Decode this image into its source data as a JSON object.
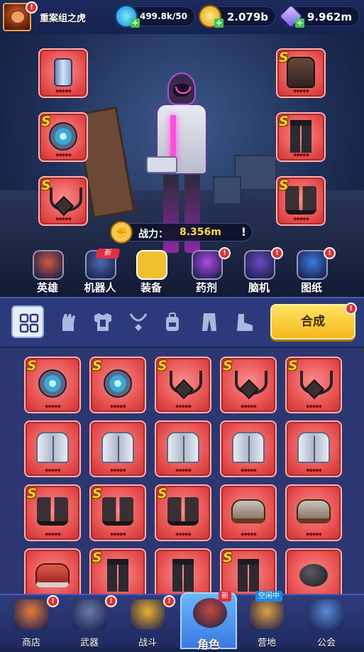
{
  "player": {
    "name": "重案组之虎"
  },
  "resources": {
    "energy": {
      "value": "499.8k/50",
      "icon": "energy-icon"
    },
    "coins": {
      "value": "2.079b",
      "icon": "coin-icon"
    },
    "gems": {
      "value": "9.962m",
      "icon": "gem-icon"
    }
  },
  "power": {
    "label": "战力：",
    "value": "8.356m",
    "info": "!"
  },
  "equipped": {
    "left": [
      {
        "item": "canister",
        "rank": "",
        "stars": 5
      },
      {
        "item": "shield",
        "rank": "S",
        "stars": 5
      },
      {
        "item": "necklace",
        "rank": "S",
        "stars": 5
      }
    ],
    "right": [
      {
        "item": "vest",
        "rank": "S",
        "stars": 5
      },
      {
        "item": "pants",
        "rank": "S",
        "stars": 5
      },
      {
        "item": "boots",
        "rank": "S",
        "stars": 5
      }
    ]
  },
  "categories": [
    {
      "label": "英雄",
      "icon": "hero-icon",
      "color": "#d05a3a",
      "new": false,
      "alert": false
    },
    {
      "label": "机器人",
      "icon": "robot-icon",
      "color": "#4a6ab0",
      "new": true,
      "new_label": "新",
      "alert": false
    },
    {
      "label": "装备",
      "icon": "equipment-icon",
      "color": "#f0c030",
      "new": false,
      "alert": false,
      "active": true
    },
    {
      "label": "药剂",
      "icon": "potion-icon",
      "color": "#b04ae0",
      "new": false,
      "alert": true
    },
    {
      "label": "脑机",
      "icon": "brain-machine-icon",
      "color": "#6a4ac0",
      "new": false,
      "alert": true
    },
    {
      "label": "图纸",
      "icon": "blueprint-icon",
      "color": "#3a7ad8",
      "new": false,
      "alert": true
    }
  ],
  "filters": [
    "all",
    "gloves",
    "armor",
    "necklace",
    "backpack",
    "pants",
    "shoes"
  ],
  "combine": {
    "label": "合成",
    "alert": "!"
  },
  "inventory": [
    {
      "item": "shield",
      "rank": "S"
    },
    {
      "item": "shield",
      "rank": "S"
    },
    {
      "item": "necklace",
      "rank": "S"
    },
    {
      "item": "necklace",
      "rank": "S"
    },
    {
      "item": "necklace",
      "rank": "S"
    },
    {
      "item": "jacket",
      "rank": ""
    },
    {
      "item": "jacket",
      "rank": ""
    },
    {
      "item": "jacket",
      "rank": ""
    },
    {
      "item": "jacket",
      "rank": ""
    },
    {
      "item": "jacket",
      "rank": ""
    },
    {
      "item": "boots",
      "rank": "S"
    },
    {
      "item": "boots",
      "rank": "S"
    },
    {
      "item": "boots",
      "rank": "S"
    },
    {
      "item": "shoes",
      "rank": ""
    },
    {
      "item": "shoes",
      "rank": ""
    },
    {
      "item": "redshoes",
      "rank": ""
    },
    {
      "item": "pants",
      "rank": "S"
    },
    {
      "item": "pants",
      "rank": ""
    },
    {
      "item": "pants",
      "rank": "S"
    },
    {
      "item": "ball",
      "rank": ""
    }
  ],
  "nav": [
    {
      "label": "商店",
      "icon": "shop-icon",
      "alert": true
    },
    {
      "label": "武器",
      "icon": "weapon-icon",
      "alert": true
    },
    {
      "label": "战斗",
      "icon": "battle-icon",
      "alert": true
    },
    {
      "label": "角色",
      "icon": "character-icon",
      "alert": false,
      "active": true,
      "tag": "新"
    },
    {
      "label": "营地",
      "icon": "camp-icon",
      "alert": false,
      "tag": "空闲中"
    },
    {
      "label": "公会",
      "icon": "guild-icon",
      "alert": false
    }
  ],
  "stars_glyph": "◆◆◆◆◆",
  "rank_glyph": "S"
}
